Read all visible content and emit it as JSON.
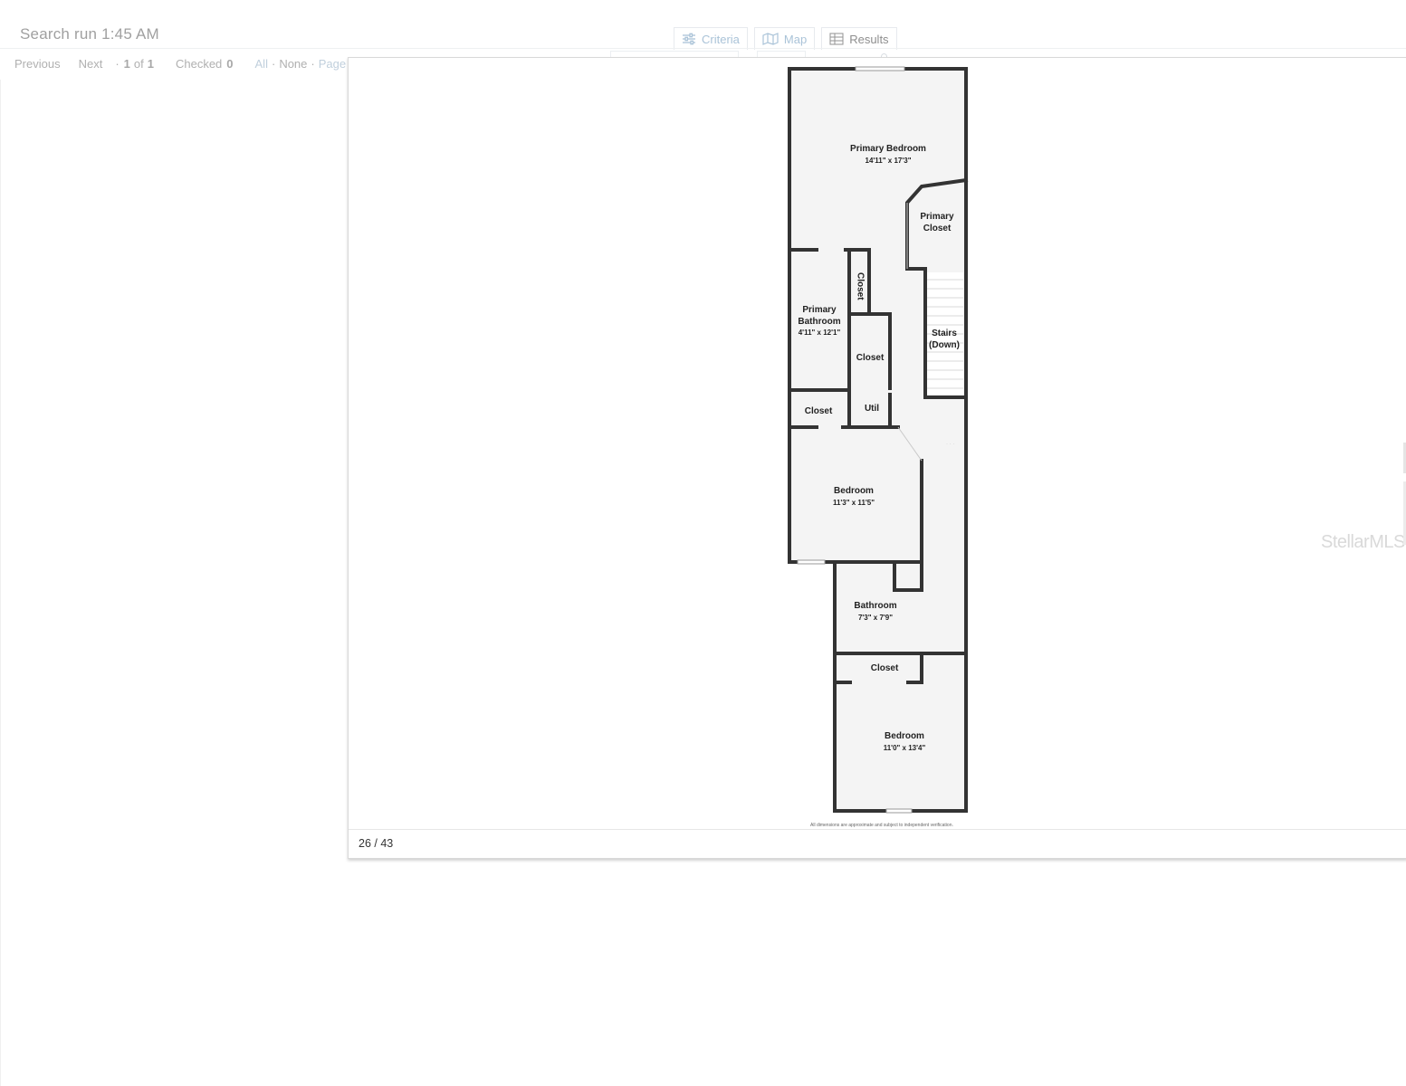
{
  "header": {
    "title": "Search run 1:45 AM"
  },
  "tabs": [
    {
      "label": "Criteria",
      "icon": "sliders-icon"
    },
    {
      "label": "Map",
      "icon": "map-icon"
    },
    {
      "label": "Results",
      "icon": "table-icon"
    }
  ],
  "pager": {
    "previous": "Previous",
    "next": "Next",
    "sep1": "·",
    "page_current": "1",
    "of": "of",
    "page_total": "1",
    "checked_label": "Checked",
    "checked_count": "0",
    "all": "All",
    "dot": "·",
    "none": "None",
    "dot2": "·",
    "page": "Page"
  },
  "viewer": {
    "counter": "26 / 43",
    "watermark": "StellarMLS",
    "fineprint": "All dimensions are approximate and subject to independent verification."
  },
  "floorplan": {
    "rooms": [
      {
        "name": "Primary Bedroom",
        "dims": "14'11\" x 17'3\""
      },
      {
        "name": "Primary\nCloset",
        "dims": ""
      },
      {
        "name": "Closet",
        "dims": ""
      },
      {
        "name": "Primary\nBathroom",
        "dims": "4'11\" x 12'1\""
      },
      {
        "name": "Closet",
        "dims": ""
      },
      {
        "name": "Stairs\n(Down)",
        "dims": ""
      },
      {
        "name": "Closet",
        "dims": ""
      },
      {
        "name": "Util",
        "dims": ""
      },
      {
        "name": "Bedroom",
        "dims": "11'3\" x 11'5\""
      },
      {
        "name": "Bathroom",
        "dims": "7'3\" x 7'9\""
      },
      {
        "name": "Closet",
        "dims": ""
      },
      {
        "name": "Bedroom",
        "dims": "11'0\" x 13'4\""
      }
    ]
  }
}
